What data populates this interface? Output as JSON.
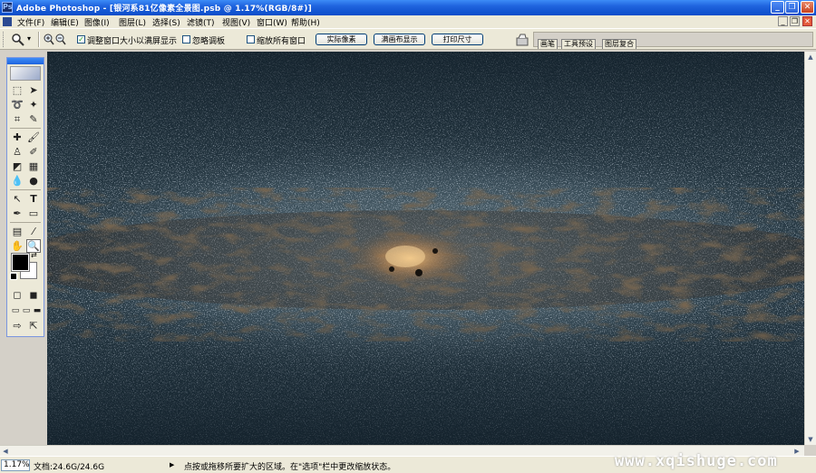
{
  "titlebar": {
    "title": "Adobe Photoshop - [银河系81亿像素全景图.psb @ 1.17%(RGB/8#)]",
    "icon": "photoshop-icon",
    "minimize": "_",
    "maximize": "❐",
    "close": "✕"
  },
  "menu": {
    "items": [
      "文件(F)",
      "编辑(E)",
      "图像(I)",
      "图层(L)",
      "选择(S)",
      "滤镜(T)",
      "视图(V)",
      "窗口(W)",
      "帮助(H)"
    ],
    "doc_minimize": "_",
    "doc_restore": "❐",
    "doc_close": "✕"
  },
  "options": {
    "zoom_tool_icon": "magnifier-icon",
    "dropdown_arrow": "▾",
    "zoom_in_icon": "zoom-in-icon",
    "zoom_out_icon": "zoom-out-icon",
    "resize_windows": {
      "label": "调整窗口大小以满屏显示",
      "checked": true
    },
    "ignore_palettes": {
      "label": "忽略调板",
      "checked": false
    },
    "zoom_all": {
      "label": "缩放所有窗口",
      "checked": false
    },
    "actual_pixels": "实际像素",
    "fit_screen": "满画布显示",
    "print_size": "打印尺寸",
    "palette_tabs": [
      "画笔",
      "工具预设",
      "图层复合"
    ]
  },
  "status": {
    "zoom": "1.17%",
    "doc_size": "文档:24.6G/24.6G",
    "menu_arrow": "▶",
    "hint": "点按或拖移所要扩大的区域。在\"选项\"栏中更改缩放状态。",
    "watermark": "www.xqishuge.com"
  },
  "colors": {
    "titlebar": "#0a4cc9",
    "chrome": "#ece9d8",
    "canvas_bg": "#1c2b35"
  }
}
